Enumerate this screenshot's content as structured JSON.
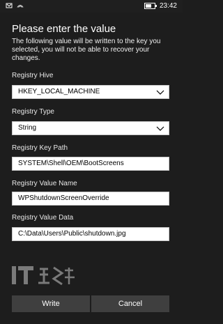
{
  "statusbar": {
    "time": "23:42",
    "left_icons": [
      "notification-icon",
      "signal-icon"
    ],
    "battery_level": 0.7
  },
  "dialog": {
    "title": "Please enter the value",
    "description": "The following value will be written to the key you selected, you will not be able to recover your changes."
  },
  "fields": {
    "hive": {
      "label": "Registry Hive",
      "value": "HKEY_LOCAL_MACHINE"
    },
    "type": {
      "label": "Registry Type",
      "value": "String"
    },
    "key_path": {
      "label": "Registry Key Path",
      "value": "SYSTEM\\Shell\\OEM\\BootScreens"
    },
    "value_name": {
      "label": "Registry Value Name",
      "value": "WPShutdownScreenOverride"
    },
    "value_data": {
      "label": "Registry Value Data",
      "value": "C:\\Data\\Users\\Public\\shutdown.jpg"
    }
  },
  "buttons": {
    "write": "Write",
    "cancel": "Cancel"
  },
  "icons": {
    "dropdown": "chevron-down-icon",
    "watermark": "it-logo-icon"
  },
  "colors": {
    "background": "#1d1d1d",
    "field_bg": "#ffffff",
    "button_bg": "#3f3f3f"
  }
}
